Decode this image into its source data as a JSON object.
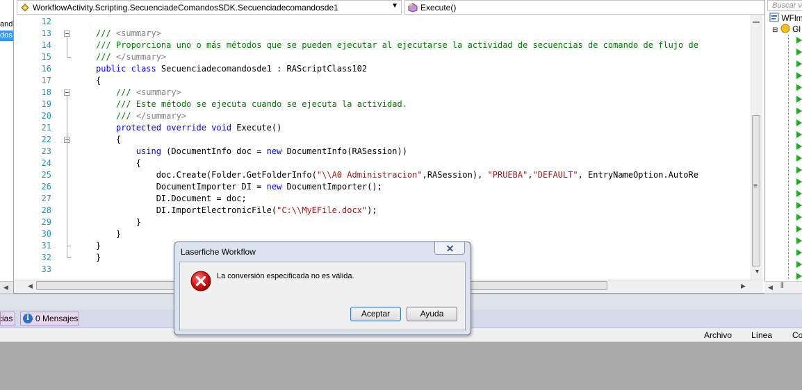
{
  "left_panel": {
    "items": [
      "and",
      "dos"
    ]
  },
  "editor": {
    "class_combo": "WorkflowActivity.Scripting.SecuenciadeComandosSDK.Secuenciadecomandosde1",
    "method_combo": "Execute()",
    "lines": [
      {
        "n": "12",
        "parts": []
      },
      {
        "n": "13",
        "parts": [
          {
            "c": "cm",
            "t": "/// "
          },
          {
            "c": "xd",
            "t": "<summary>"
          }
        ]
      },
      {
        "n": "14",
        "parts": [
          {
            "c": "cm",
            "t": "/// Proporciona uno o más métodos que se pueden ejecutar al ejecutarse la actividad de secuencias de comando de flujo de"
          }
        ]
      },
      {
        "n": "15",
        "parts": [
          {
            "c": "cm",
            "t": "/// "
          },
          {
            "c": "xd",
            "t": "</summary>"
          }
        ]
      },
      {
        "n": "16",
        "parts": [
          {
            "c": "kw",
            "t": "public class "
          },
          {
            "c": "tx",
            "t": "Secuenciadecomandosde1 : RAScriptClass102"
          }
        ]
      },
      {
        "n": "17",
        "parts": [
          {
            "c": "tx",
            "t": "{"
          }
        ]
      },
      {
        "n": "18",
        "parts": [
          {
            "c": "tx",
            "t": "    "
          },
          {
            "c": "cm",
            "t": "/// "
          },
          {
            "c": "xd",
            "t": "<summary>"
          }
        ]
      },
      {
        "n": "19",
        "parts": [
          {
            "c": "tx",
            "t": "    "
          },
          {
            "c": "cm",
            "t": "/// Este método se ejecuta cuando se ejecuta la actividad."
          }
        ]
      },
      {
        "n": "20",
        "parts": [
          {
            "c": "tx",
            "t": "    "
          },
          {
            "c": "cm",
            "t": "/// "
          },
          {
            "c": "xd",
            "t": "</summary>"
          }
        ]
      },
      {
        "n": "21",
        "parts": [
          {
            "c": "tx",
            "t": "    "
          },
          {
            "c": "kw",
            "t": "protected override void "
          },
          {
            "c": "tx",
            "t": "Execute()"
          }
        ]
      },
      {
        "n": "22",
        "parts": [
          {
            "c": "tx",
            "t": "    {"
          }
        ]
      },
      {
        "n": "23",
        "parts": [
          {
            "c": "tx",
            "t": "        "
          },
          {
            "c": "kw",
            "t": "using "
          },
          {
            "c": "tx",
            "t": "(DocumentInfo doc = "
          },
          {
            "c": "kw",
            "t": "new "
          },
          {
            "c": "tx",
            "t": "DocumentInfo(RASession))"
          }
        ]
      },
      {
        "n": "24",
        "parts": [
          {
            "c": "tx",
            "t": "        {"
          }
        ]
      },
      {
        "n": "25",
        "parts": [
          {
            "c": "tx",
            "t": "            doc.Create(Folder.GetFolderInfo("
          },
          {
            "c": "st",
            "t": "\"\\\\A0 Administracion\""
          },
          {
            "c": "tx",
            "t": ",RASession), "
          },
          {
            "c": "st",
            "t": "\"PRUEBA\""
          },
          {
            "c": "tx",
            "t": ","
          },
          {
            "c": "st",
            "t": "\"DEFAULT\""
          },
          {
            "c": "tx",
            "t": ", EntryNameOption.AutoRe"
          }
        ]
      },
      {
        "n": "26",
        "parts": [
          {
            "c": "tx",
            "t": "            DocumentImporter DI = "
          },
          {
            "c": "kw",
            "t": "new "
          },
          {
            "c": "tx",
            "t": "DocumentImporter();"
          }
        ]
      },
      {
        "n": "27",
        "parts": [
          {
            "c": "tx",
            "t": "            DI.Document = doc;"
          }
        ]
      },
      {
        "n": "28",
        "parts": [
          {
            "c": "tx",
            "t": "            DI.ImportElectronicFile("
          },
          {
            "c": "st",
            "t": "\"C:\\\\MyEFile.docx\""
          },
          {
            "c": "tx",
            "t": ");"
          }
        ]
      },
      {
        "n": "29",
        "parts": [
          {
            "c": "tx",
            "t": "        }"
          }
        ]
      },
      {
        "n": "30",
        "parts": [
          {
            "c": "tx",
            "t": "    }"
          }
        ]
      },
      {
        "n": "31",
        "parts": [
          {
            "c": "tx",
            "t": "}"
          }
        ]
      },
      {
        "n": "32",
        "parts": [
          {
            "c": "tx",
            "t": "}"
          }
        ]
      },
      {
        "n": "33",
        "parts": []
      }
    ]
  },
  "right_panel": {
    "search_placeholder": "Buscar v",
    "root_label": "WFlm",
    "child_label": "Gl"
  },
  "bottom_tabs": {
    "warnings_label": "cias",
    "messages_label": "0 Mensajes"
  },
  "status_bar": {
    "col_file": "Archivo",
    "col_line": "Línea",
    "col_col": "Co"
  },
  "dialog": {
    "title": "Laserfiche Workflow",
    "message": "La conversión especificada no es válida.",
    "ok_label": "Aceptar",
    "help_label": "Ayuda"
  }
}
